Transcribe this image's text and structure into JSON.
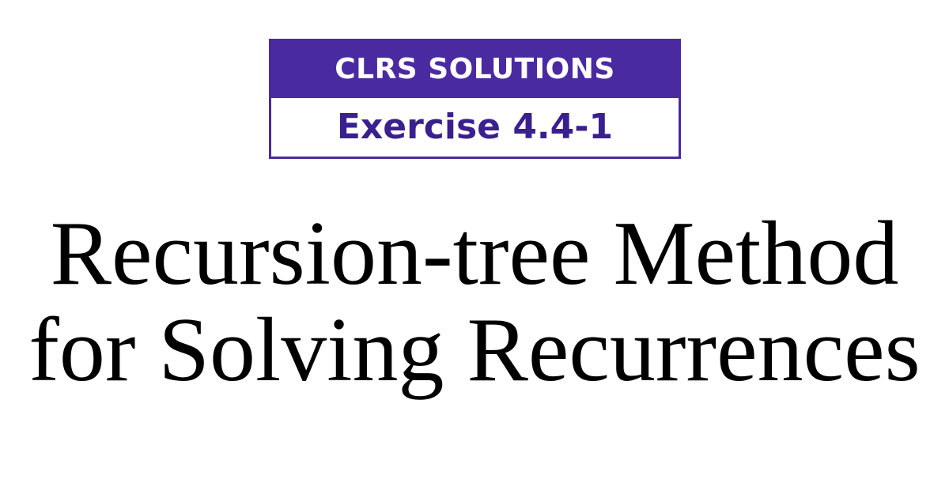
{
  "badge": {
    "header": "CLRS SOLUTIONS",
    "exercise": "Exercise 4.4-1",
    "colors": {
      "accent": "#4a2aa0",
      "exercise_text": "#3a1f8f"
    }
  },
  "title": {
    "line1": "Recursion-tree Method",
    "line2": "for Solving Recurrences"
  }
}
